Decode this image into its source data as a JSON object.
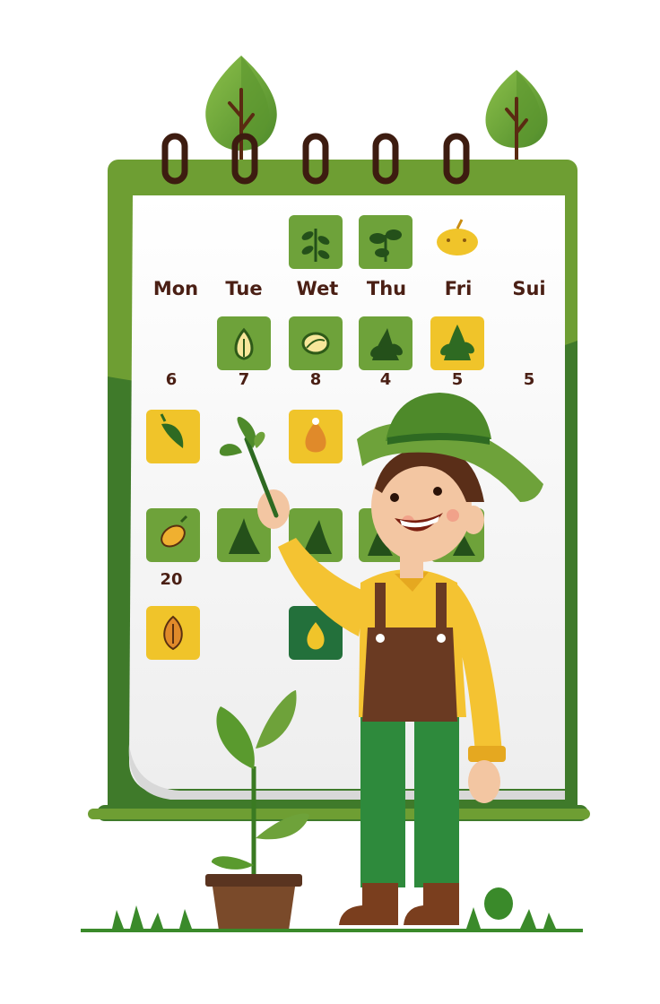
{
  "calendar": {
    "day_headers": [
      "Mon",
      "Tue",
      "Wet",
      "Thu",
      "Fri",
      "Sui"
    ],
    "week_numbers": [
      "6",
      "7",
      "8",
      "4",
      "5",
      "5"
    ],
    "extra_number": "20"
  },
  "icons": {
    "header_tiles": [
      "herb-sprig-icon",
      "seedling-icon",
      "lemon-icon"
    ],
    "row1_tiles": [
      "seed-sprout-icon",
      "bean-icon",
      "leafy-plant-icon",
      "leafy-bush-icon"
    ],
    "row2_tiles": [
      "pepper-icon",
      "seed-drop-icon"
    ],
    "row3_tiles": [
      "mango-icon",
      "leaf-cluster-icon",
      "leaf-cluster-icon",
      "leaf-cluster-icon",
      "leaf-cluster-icon"
    ],
    "row4_tiles": [
      "almond-seed-icon",
      "oil-drop-icon"
    ]
  },
  "colors": {
    "calendar_green": "#6e9e33",
    "tile_green": "#6ea23a",
    "tile_yellow": "#f0c42a",
    "dark_tile": "#23703b",
    "text_brown": "#4a1f14",
    "shirt_yellow": "#f4c332",
    "overalls_brown": "#6a3a22",
    "pants_green": "#2e8a3c"
  }
}
